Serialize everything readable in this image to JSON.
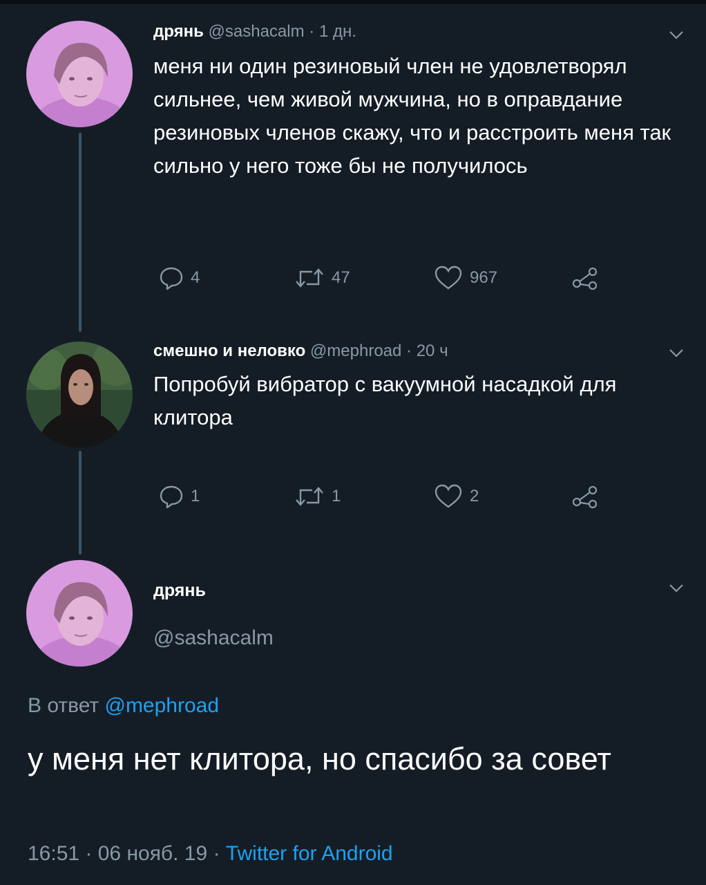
{
  "thread": [
    {
      "name": "дрянь",
      "handle": "@sashacalm",
      "time": "1 дн.",
      "separator": "·",
      "text": "меня ни один резиновый член не удовлетворял сильнее, чем живой мужчина, но в оправдание резиновых членов скажу, что и расстроить меня так сильно у него тоже бы не получилось",
      "replies": "4",
      "retweets": "47",
      "likes": "967"
    },
    {
      "name": "смешно и неловко",
      "handle": "@mephroad",
      "time": "20 ч",
      "separator": "·",
      "text": "Попробуй вибратор с вакуумной насадкой для клитора",
      "replies": "1",
      "retweets": "1",
      "likes": "2"
    }
  ],
  "main": {
    "name": "дрянь",
    "handle": "@sashacalm",
    "reply_prefix": "В ответ",
    "reply_mention": "@mephroad",
    "text": "у меня нет клитора, но спасибо за совет",
    "timestamp": "16:51 · 06 нояб. 19 ·",
    "source": "Twitter for Android"
  },
  "colors": {
    "background": "#141d26",
    "secondary_text": "#8899a6",
    "link": "#1da1f2",
    "thread_line": "#3d5466"
  },
  "icons": [
    "reply-icon",
    "retweet-icon",
    "like-icon",
    "share-icon",
    "chevron-down-icon"
  ]
}
